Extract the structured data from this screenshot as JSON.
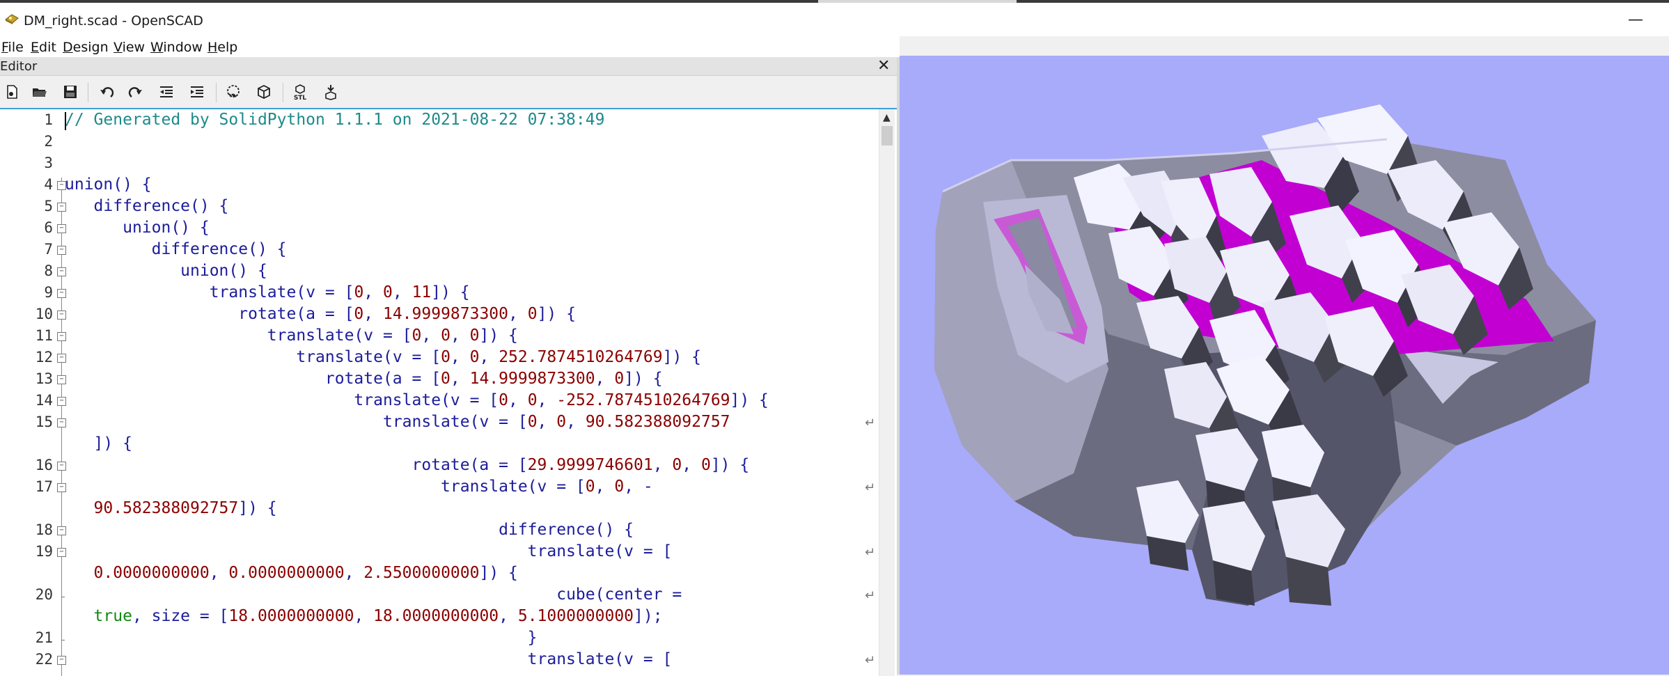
{
  "window": {
    "title": "DM_right.scad - OpenSCAD",
    "minimize_symbol": "—"
  },
  "menu": [
    {
      "underline": "F",
      "rest": "ile"
    },
    {
      "underline": "E",
      "rest": "dit"
    },
    {
      "underline": "D",
      "rest": "esign"
    },
    {
      "underline": "V",
      "rest": "iew"
    },
    {
      "underline": "W",
      "rest": "indow"
    },
    {
      "underline": "H",
      "rest": "elp"
    }
  ],
  "editor": {
    "title": "Editor",
    "close_symbol": "✕"
  },
  "toolbar": {
    "icons": [
      "new-file-icon",
      "open-file-icon",
      "save-icon",
      "undo-icon",
      "redo-icon",
      "unindent-icon",
      "indent-icon",
      "preview-icon",
      "render-icon",
      "export-stl-icon",
      "send-to-3d-print-icon"
    ],
    "stl_label": "STL"
  },
  "code": {
    "line_numbers": [
      "1",
      "2",
      "3",
      "4",
      "5",
      "6",
      "7",
      "8",
      "9",
      "10",
      "11",
      "12",
      "13",
      "14",
      "15",
      "16",
      "17",
      "18",
      "19",
      "20",
      "21",
      "22"
    ],
    "lines": {
      "l1": "// Generated by SolidPython 1.1.1 on 2021-08-22 07:38:49",
      "l4": "union() {",
      "l5": "difference() {",
      "l6": "union() {",
      "l7": "difference() {",
      "l8": "union() {",
      "l9a": "translate(v = [",
      "l9b": "0",
      "l9c": ", ",
      "l9d": "0",
      "l9e": ", ",
      "l9f": "11",
      "l9g": "]) {",
      "l10a": "rotate(a = [",
      "l10b": "0",
      "l10c": ", ",
      "l10d": "14.9999873300",
      "l10e": ", ",
      "l10f": "0",
      "l10g": "]) {",
      "l11a": "translate(v = [",
      "l11b": "0",
      "l11c": ", ",
      "l11d": "0",
      "l11e": ", ",
      "l11f": "0",
      "l11g": "]) {",
      "l12a": "translate(v = [",
      "l12b": "0",
      "l12c": ", ",
      "l12d": "0",
      "l12e": ", ",
      "l12f": "252.7874510264769",
      "l12g": "]) {",
      "l13a": "rotate(a = [",
      "l13b": "0",
      "l13c": ", ",
      "l13d": "14.9999873300",
      "l13e": ", ",
      "l13f": "0",
      "l13g": "]) {",
      "l14a": "translate(v = [",
      "l14b": "0",
      "l14c": ", ",
      "l14d": "0",
      "l14e": ", ",
      "l14f": "-252.7874510264769",
      "l14g": "]) {",
      "l15a": "translate(v = [",
      "l15b": "0",
      "l15c": ", ",
      "l15d": "0",
      "l15e": ", ",
      "l15f": "90.582388092757",
      "l15w": "]) {",
      "l16a": "rotate(a = [",
      "l16b": "29.9999746601",
      "l16c": ", ",
      "l16d": "0",
      "l16e": ", ",
      "l16f": "0",
      "l16g": "]) {",
      "l17a": "translate(v = [",
      "l17b": "0",
      "l17c": ", ",
      "l17d": "0",
      "l17e": ", -",
      "l17w1": "90.582388092757",
      "l17w2": "]) {",
      "l18": "difference() {",
      "l19": "translate(v = [",
      "l19w1": "0.0000000000",
      "l19w2": ", ",
      "l19w3": "0.0000000000",
      "l19w4": ", ",
      "l19w5": "2.5500000000",
      "l19w6": "]) {",
      "l20": "cube(center =",
      "l20w1": "true",
      "l20w2": ", size = [",
      "l20w3": "18.0000000000",
      "l20w4": ", ",
      "l20w5": "18.0000000000",
      "l20w6": ", ",
      "l20w7": "5.1000000000",
      "l20w8": "]);",
      "l21": "}",
      "l22": "translate(v = ["
    },
    "wrap_symbol": "↵"
  }
}
